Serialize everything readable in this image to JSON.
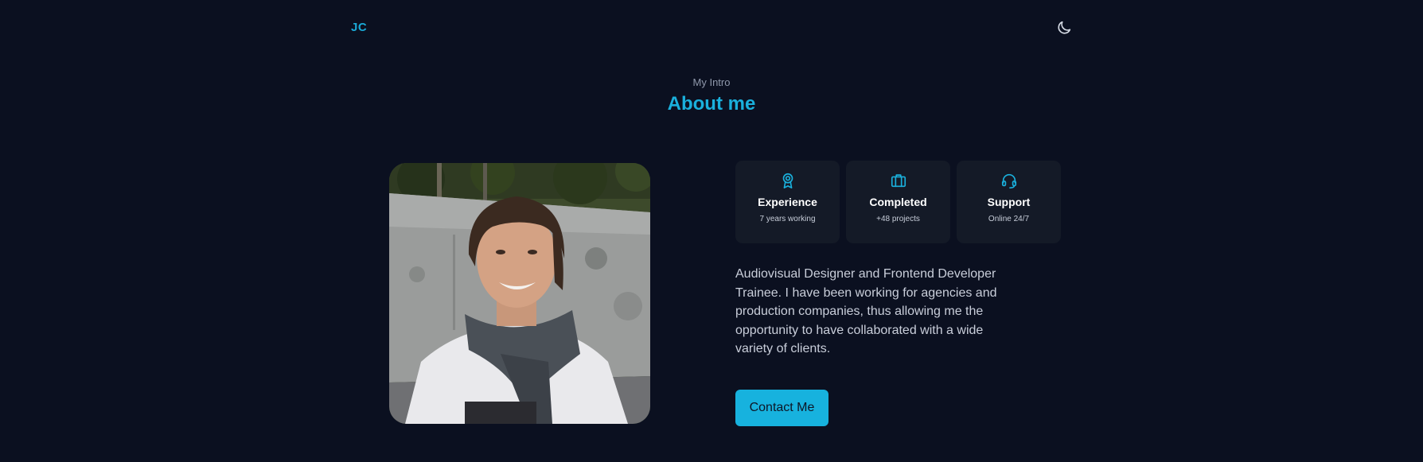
{
  "header": {
    "logo": "JC",
    "theme_icon": "moon-icon"
  },
  "about": {
    "subtitle": "My Intro",
    "title": "About me",
    "cards": [
      {
        "icon": "award-icon",
        "title": "Experience",
        "subtitle": "7 years working"
      },
      {
        "icon": "briefcase-icon",
        "title": "Completed",
        "subtitle": "+48 projects"
      },
      {
        "icon": "headset-icon",
        "title": "Support",
        "subtitle": "Online 24/7"
      }
    ],
    "description": "Audiovisual Designer and Frontend Developer Trainee. I have been working for agencies and production companies, thus allowing me the opportunity to have collaborated with a wide variety of clients.",
    "button_label": "Contact Me"
  },
  "colors": {
    "background": "#0b1020",
    "accent": "#1ab0dc",
    "card": "#141a27"
  }
}
